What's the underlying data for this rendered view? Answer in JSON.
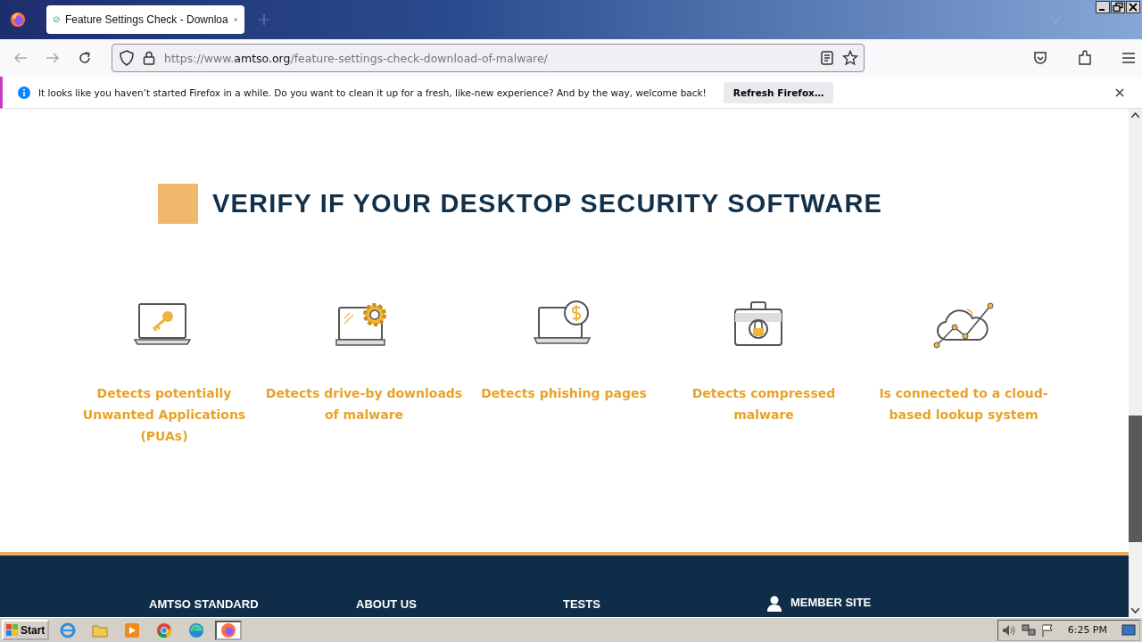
{
  "browser": {
    "tab": {
      "title": "Feature Settings Check - Downloa",
      "selected": true
    },
    "url": {
      "scheme": "https://www.",
      "domain": "amtso.org",
      "path": "/feature-settings-check-download-of-malware/"
    },
    "notification": {
      "message": "It looks like you haven’t started Firefox in a while. Do you want to clean it up for a fresh, like-new experience? And by the way, welcome back!",
      "button": "Refresh Firefox…"
    }
  },
  "page": {
    "heading": "VERIFY IF YOUR DESKTOP SECURITY SOFTWARE",
    "features": [
      {
        "kind": "key",
        "label": "Detects potentially Unwanted Applications (PUAs)"
      },
      {
        "kind": "gear",
        "label": "Detects drive-by downloads of malware"
      },
      {
        "kind": "dollar",
        "label": "Detects phishing pages"
      },
      {
        "kind": "briefcase",
        "label": "Detects compressed malware"
      },
      {
        "kind": "cloud",
        "label": "Is connected to a cloud-based lookup system"
      }
    ],
    "footer": {
      "links": [
        {
          "kind": "text",
          "label": "AMTSO STANDARD"
        },
        {
          "kind": "text",
          "label": "ABOUT US"
        },
        {
          "kind": "text",
          "label": "TESTS"
        },
        {
          "kind": "user",
          "label": "MEMBER SITE"
        }
      ]
    }
  },
  "taskbar": {
    "start": "Start",
    "apps": [
      {
        "kind": "ie",
        "selected": false
      },
      {
        "kind": "folder",
        "selected": false
      },
      {
        "kind": "media",
        "selected": false
      },
      {
        "kind": "chrome",
        "selected": false
      },
      {
        "kind": "edge",
        "selected": false
      },
      {
        "kind": "firefox",
        "selected": true
      }
    ],
    "clock": "6:25 PM"
  }
}
